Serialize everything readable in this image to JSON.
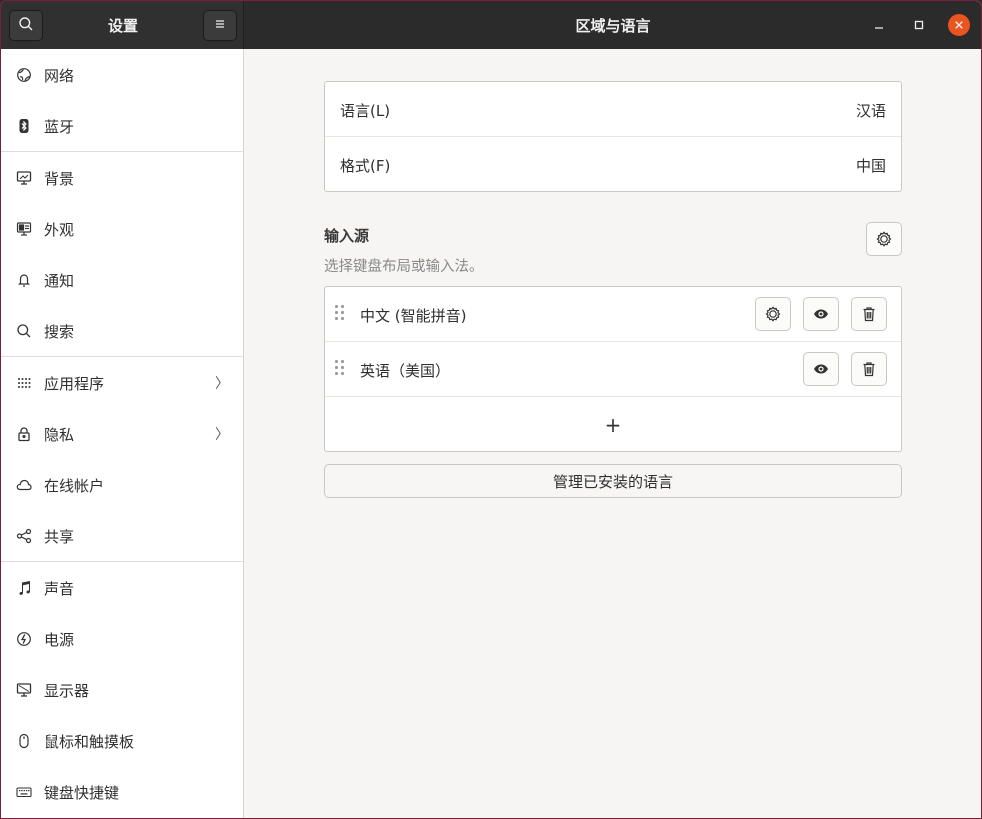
{
  "header": {
    "sidebar_title": "设置",
    "title": "区域与语言",
    "search_icon": "search-icon",
    "menu_icon": "menu-icon",
    "minimize": "–",
    "maximize": "▢",
    "close": "✕"
  },
  "sidebar": {
    "items": [
      {
        "label": "网络",
        "icon": "network-icon"
      },
      {
        "label": "蓝牙",
        "icon": "bluetooth-icon"
      },
      {
        "label": "背景",
        "icon": "background-icon"
      },
      {
        "label": "外观",
        "icon": "appearance-icon"
      },
      {
        "label": "通知",
        "icon": "bell-icon"
      },
      {
        "label": "搜索",
        "icon": "search-icon"
      },
      {
        "label": "应用程序",
        "icon": "apps-grid-icon",
        "chevron": "〉"
      },
      {
        "label": "隐私",
        "icon": "lock-icon",
        "chevron": "〉"
      },
      {
        "label": "在线帐户",
        "icon": "cloud-icon"
      },
      {
        "label": "共享",
        "icon": "share-icon"
      },
      {
        "label": "声音",
        "icon": "music-note-icon"
      },
      {
        "label": "电源",
        "icon": "power-icon"
      },
      {
        "label": "显示器",
        "icon": "display-icon"
      },
      {
        "label": "鼠标和触摸板",
        "icon": "mouse-icon"
      },
      {
        "label": "键盘快捷键",
        "icon": "keyboard-icon"
      }
    ]
  },
  "region": {
    "language_label": "语言(L)",
    "language_value": "汉语",
    "formats_label": "格式(F)",
    "formats_value": "中国"
  },
  "input_sources": {
    "title": "输入源",
    "subtitle": "选择键盘布局或输入法。",
    "sources": [
      {
        "label": "中文 (智能拼音)",
        "has_settings": true
      },
      {
        "label": "英语（美国）",
        "has_settings": false
      }
    ],
    "add_label": "+"
  },
  "manage_button": "管理已安装的语言",
  "colors": {
    "accent": "#e95420",
    "header_bg": "#2b2b2b",
    "content_bg": "#f6f5f4"
  }
}
